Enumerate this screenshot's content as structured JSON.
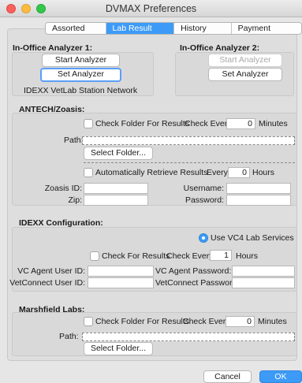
{
  "window": {
    "title": "DVMAX Preferences"
  },
  "tabs": [
    {
      "label": "Assorted Prefs",
      "active": false
    },
    {
      "label": "Lab Result Setup",
      "active": true
    },
    {
      "label": "History Filters",
      "active": false
    },
    {
      "label": "Payment Terminal",
      "active": false
    }
  ],
  "analyzer1": {
    "heading": "In-Office Analyzer 1:",
    "start_label": "Start Analyzer",
    "set_label": "Set Analyzer",
    "status": "IDEXX VetLab Station Network"
  },
  "analyzer2": {
    "heading": "In-Office Analyzer 2:",
    "start_label": "Start Analyzer",
    "set_label": "Set Analyzer"
  },
  "antech": {
    "heading": "ANTECH/Zoasis:",
    "check_folder_label": "Check Folder For Results",
    "check_every_label": "Check Every:",
    "check_every_value": "0",
    "minutes_label": "Minutes",
    "path_label": "Path:",
    "select_folder_label": "Select Folder...",
    "auto_retrieve_label": "Automatically Retrieve Results",
    "every_label": "Every",
    "every_value": "0",
    "hours_label": "Hours",
    "zoasis_id_label": "Zoasis ID:",
    "zip_label": "Zip:",
    "username_label": "Username:",
    "password_label": "Password:"
  },
  "idexx": {
    "heading": "IDEXX Configuration:",
    "vc4_label": "Use VC4 Lab Services",
    "check_folder_label": "Check For Results",
    "check_every_label": "Check Every:",
    "check_every_value": "1",
    "hours_label": "Hours",
    "vc_agent_user_label": "VC Agent User ID:",
    "vetconnect_user_label": "VetConnect User ID:",
    "vc_agent_pass_label": "VC Agent Password:",
    "vetconnect_pass_label": "VetConnect Password:"
  },
  "marshfield": {
    "heading": "Marshfield Labs:",
    "check_folder_label": "Check Folder For Results",
    "check_every_label": "Check Every:",
    "check_every_value": "0",
    "minutes_label": "Minutes",
    "path_label": "Path:",
    "select_folder_label": "Select Folder..."
  },
  "footer": {
    "cancel_label": "Cancel",
    "ok_label": "OK"
  }
}
